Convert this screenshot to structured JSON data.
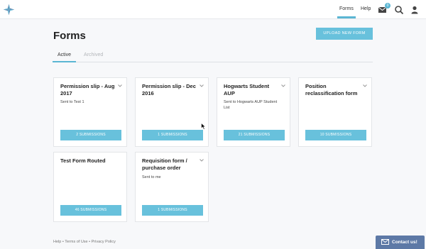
{
  "nav": {
    "items": [
      {
        "label": "Forms",
        "active": true
      },
      {
        "label": "Help",
        "active": false
      }
    ],
    "mail_badge": "0",
    "icons": [
      "logo-icon",
      "mail-icon",
      "search-icon",
      "user-icon"
    ]
  },
  "page": {
    "title": "Forms",
    "upload_label": "UPLOAD NEW FORM"
  },
  "tabs": [
    {
      "label": "Active",
      "active": true
    },
    {
      "label": "Archived",
      "active": false
    }
  ],
  "cards": [
    {
      "title": "Permission slip - Aug 2017",
      "description": "Sent to Test 1",
      "submissions": "2 SUBMISSIONS"
    },
    {
      "title": "Permission slip - Dec 2016",
      "description": "",
      "submissions": "1 SUBMISSIONS"
    },
    {
      "title": "Hogwarts Student AUP",
      "description": "Sent to Hogwarts AUP Student List",
      "submissions": "21 SUBMISSIONS"
    },
    {
      "title": "Position reclassification form",
      "description": "",
      "submissions": "10 SUBMISSIONS"
    },
    {
      "title": "Test Form Routed",
      "description": "",
      "submissions": "46 SUBMISSIONS"
    },
    {
      "title": "Requisition form / purchase order",
      "description": "Sent to me",
      "submissions": "1 SUBMISSIONS"
    }
  ],
  "footer": {
    "help": "Help",
    "terms": "Terms of Use",
    "privacy": "Privacy Policy",
    "separator": "•"
  },
  "contact": {
    "label": "Contact us!"
  },
  "colors": {
    "accent": "#68c1dc",
    "contact": "#5d79a6"
  }
}
